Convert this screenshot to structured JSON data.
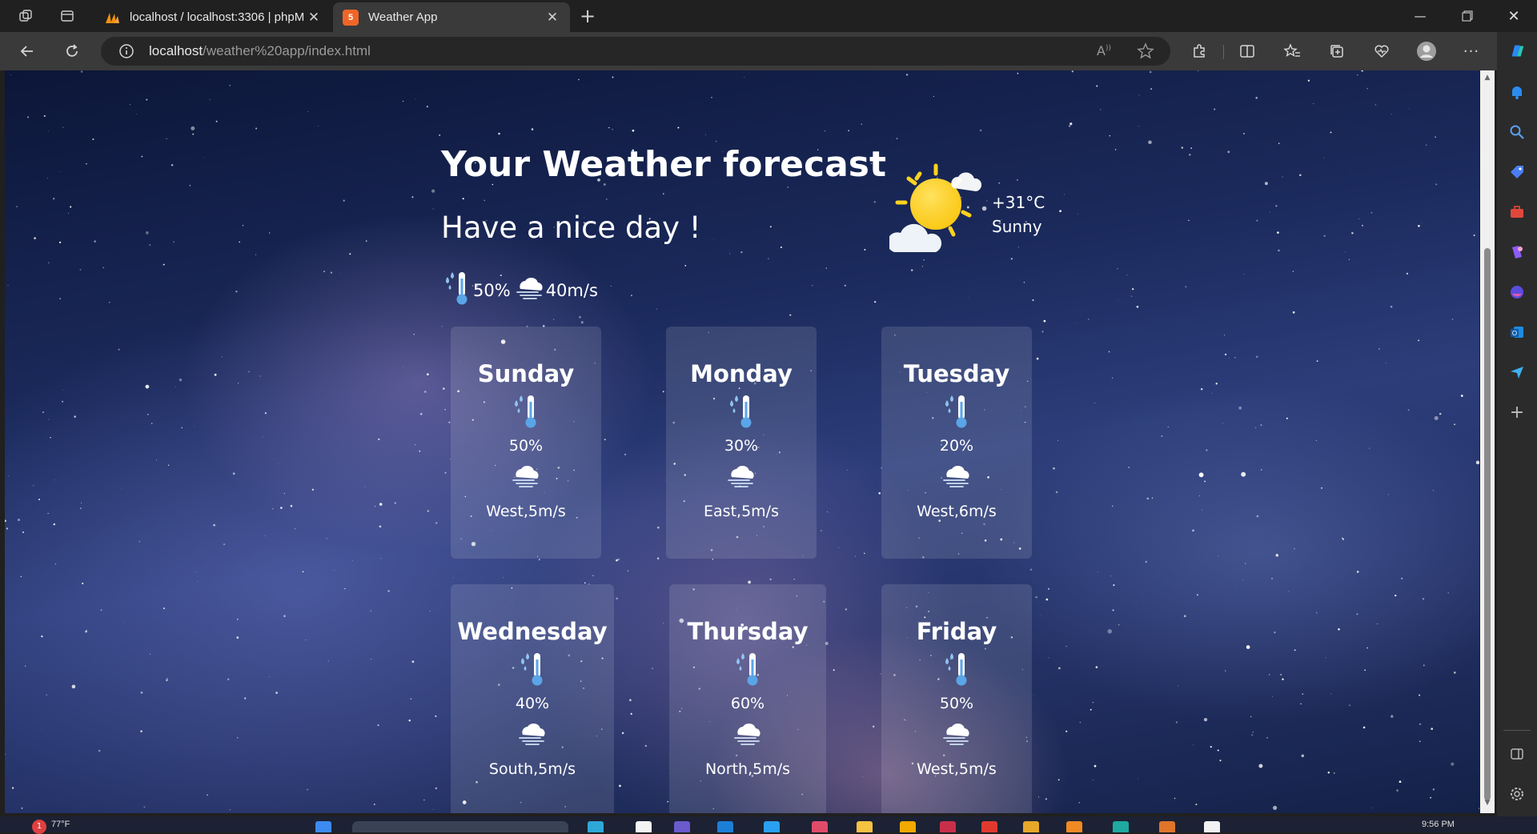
{
  "browser": {
    "tabs": [
      {
        "title": "localhost / localhost:3306 | phpM",
        "favicon": "phpmyadmin-icon",
        "active": false
      },
      {
        "title": "Weather App",
        "favicon": "html5-icon",
        "active": true
      }
    ],
    "url_host": "localhost",
    "url_path": "/weather%20app/index.html"
  },
  "page": {
    "heading": "Your Weather forecast",
    "subheading": "Have a nice day !",
    "humidity": "50%",
    "wind": "40m/s",
    "current_temp": "+31°C",
    "current_condition": "Sunny"
  },
  "forecast": [
    {
      "day": "Sunday",
      "humidity": "50%",
      "wind": "West,5m/s"
    },
    {
      "day": "Monday",
      "humidity": "30%",
      "wind": "East,5m/s"
    },
    {
      "day": "Tuesday",
      "humidity": "20%",
      "wind": "West,6m/s"
    },
    {
      "day": "Wednesday",
      "humidity": "40%",
      "wind": "South,5m/s"
    },
    {
      "day": "Thursday",
      "humidity": "60%",
      "wind": "North,5m/s"
    },
    {
      "day": "Friday",
      "humidity": "50%",
      "wind": "West,5m/s"
    }
  ],
  "taskbar": {
    "weather": "77°F",
    "notification_count": "1",
    "clock": "9:56 PM"
  },
  "colors": {
    "accent": "#0078d4",
    "sun": "#ffd21f",
    "thermo": "#8ec5f0"
  }
}
